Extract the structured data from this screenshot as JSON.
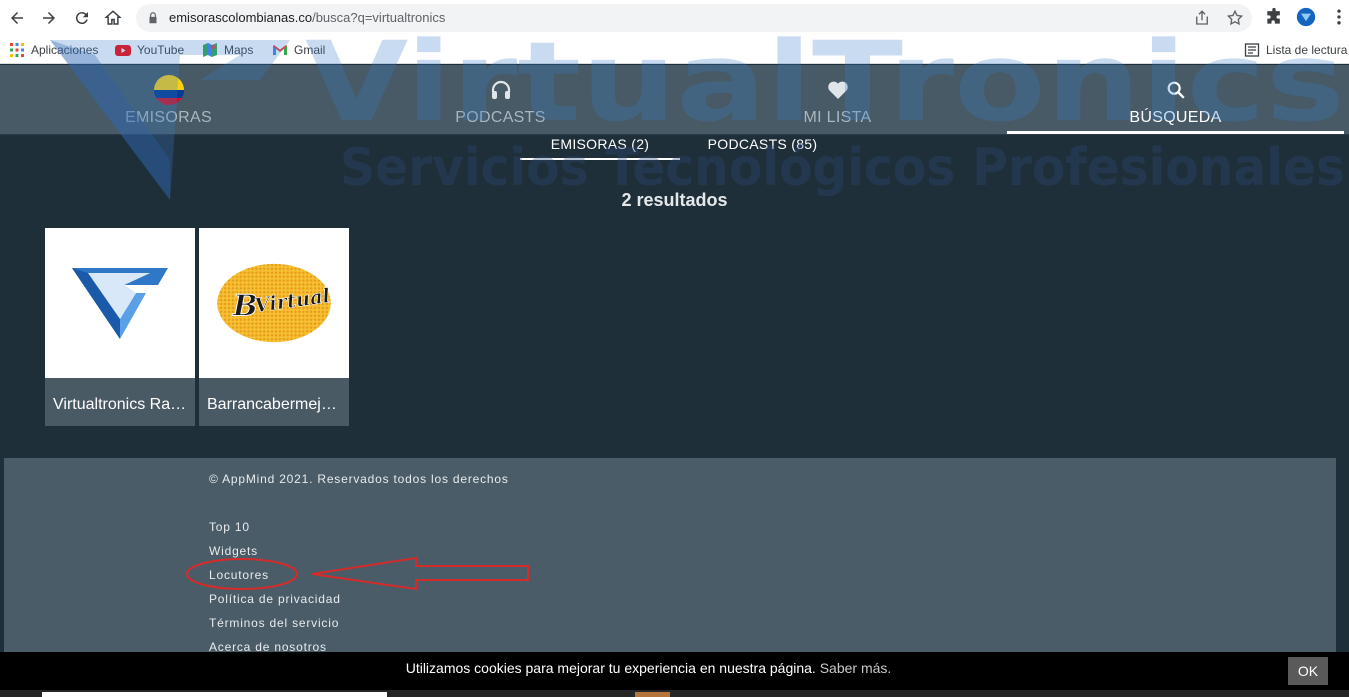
{
  "browser": {
    "url_host": "emisorascolombianas.co",
    "url_path": "/busca?q=virtualtronics",
    "bookmarks": [
      {
        "label": "Aplicaciones",
        "icon": "apps-grid-icon"
      },
      {
        "label": "YouTube",
        "icon": "youtube-icon"
      },
      {
        "label": "Maps",
        "icon": "maps-icon"
      },
      {
        "label": "Gmail",
        "icon": "gmail-icon"
      }
    ],
    "reading_list": "Lista de lectura"
  },
  "header": {
    "tabs": [
      {
        "label": "EMISORAS",
        "icon": "colombia-flag-icon"
      },
      {
        "label": "PODCASTS",
        "icon": "headphones-icon"
      },
      {
        "label": "MI LISTA",
        "icon": "heart-icon"
      },
      {
        "label": "BÚSQUEDA",
        "icon": "search-icon"
      }
    ],
    "active_tab": "BÚSQUEDA"
  },
  "subtabs": [
    {
      "label": "EMISORAS (2)"
    },
    {
      "label": "PODCASTS (85)"
    }
  ],
  "results": {
    "count_label": "2 resultados",
    "items": [
      {
        "title": "Virtualtronics Radio",
        "logo": "virtualtronics-logo"
      },
      {
        "title": "Barrancabermeja Virtual",
        "logo": "bvirtual-logo"
      }
    ]
  },
  "footer": {
    "copyright": "© AppMind 2021. Reservados todos los derechos",
    "links": [
      "Top 10",
      "Widgets",
      "Locutores",
      "Política de privacidad",
      "Términos del servicio",
      "Acerca de nosotros"
    ]
  },
  "cookie": {
    "text": "Utilizamos cookies para mejorar tu experiencia en nuestra página.",
    "link": "Saber más.",
    "ok": "OK"
  },
  "colors": {
    "header_bg": "#475a66",
    "page_bg": "#1f2f3a",
    "footer_bg": "#4a5c67",
    "annotation": "#d62b2b"
  }
}
